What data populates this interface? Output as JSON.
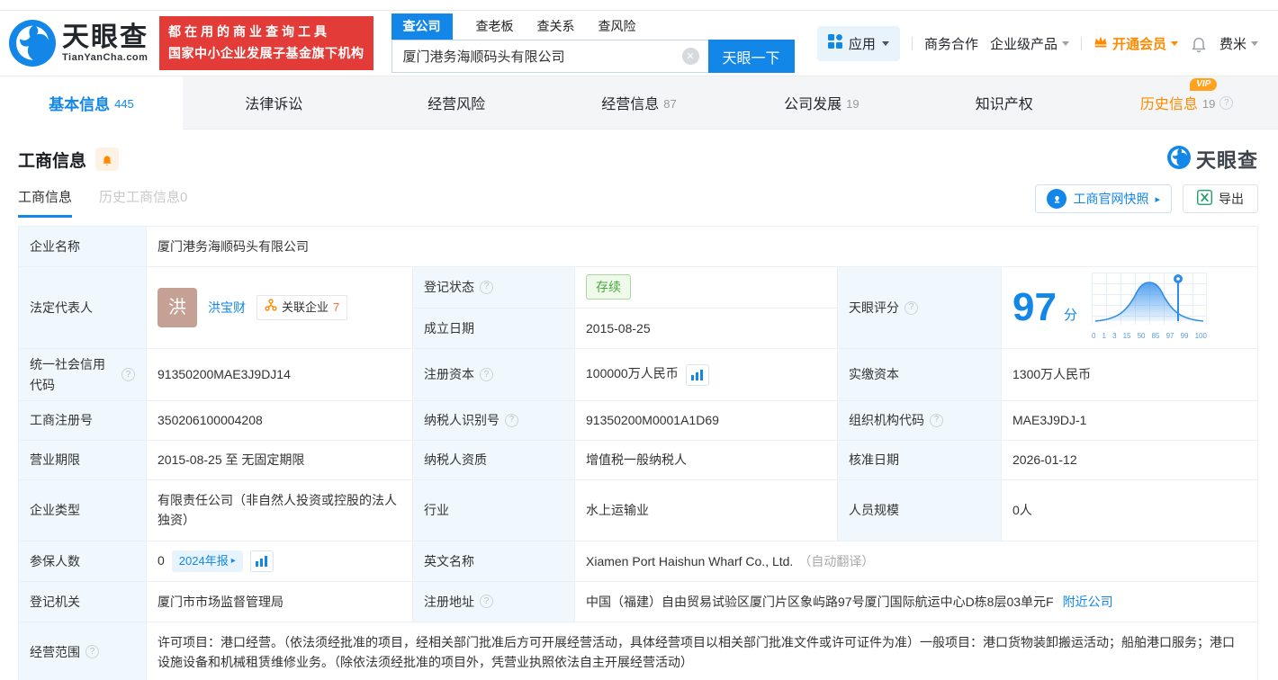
{
  "header": {
    "brand": "天眼查",
    "brand_domain": "TianYanCha.com",
    "slogan_line1": "都在用的商业查询工具",
    "slogan_line2": "国家中小企业发展子基金旗下机构",
    "search_tabs": [
      {
        "label": "查公司"
      },
      {
        "label": "查老板"
      },
      {
        "label": "查关系"
      },
      {
        "label": "查风险"
      }
    ],
    "search_value": "厦门港务海顺码头有限公司",
    "search_button": "天眼一下",
    "menu": {
      "apps": "应用",
      "cooperation": "商务合作",
      "enterprise": "企业级产品",
      "vip": "开通会员",
      "user": "费米"
    }
  },
  "nav_tabs": [
    {
      "label": "基本信息",
      "count": "445"
    },
    {
      "label": "法律诉讼",
      "count": ""
    },
    {
      "label": "经营风险",
      "count": ""
    },
    {
      "label": "经营信息",
      "count": "87"
    },
    {
      "label": "公司发展",
      "count": "19"
    },
    {
      "label": "知识产权",
      "count": ""
    },
    {
      "label": "历史信息",
      "count": "19",
      "vip": "VIP"
    }
  ],
  "section": {
    "title": "工商信息",
    "watermark": "天眼查",
    "subtab_active": "工商信息",
    "subtab_history": "历史工商信息0",
    "snapshot_button": "工商官网快照",
    "export_button": "导出"
  },
  "table": {
    "company_name_label": "企业名称",
    "company_name": "厦门港务海顺码头有限公司",
    "legal_rep_label": "法定代表人",
    "legal_rep_avatar": "洪",
    "legal_rep_name": "洪宝财",
    "related_label": "关联企业",
    "related_count": "7",
    "reg_status_label": "登记状态",
    "reg_status": "存续",
    "establish_date_label": "成立日期",
    "establish_date": "2015-08-25",
    "score_label": "天眼评分",
    "score": "97",
    "score_unit": "分",
    "score_axis": [
      "0",
      "1",
      "3",
      "15",
      "50",
      "85",
      "97",
      "99",
      "100"
    ],
    "credit_code_label": "统一社会信用代码",
    "credit_code": "91350200MAE3J9DJ14",
    "reg_capital_label": "注册资本",
    "reg_capital": "100000万人民币",
    "paid_capital_label": "实缴资本",
    "paid_capital": "1300万人民币",
    "reg_number_label": "工商注册号",
    "reg_number": "350206100004208",
    "taxpayer_id_label": "纳税人识别号",
    "taxpayer_id": "91350200M0001A1D69",
    "org_code_label": "组织机构代码",
    "org_code": "MAE3J9DJ-1",
    "business_term_label": "营业期限",
    "business_term": "2015-08-25 至 无固定期限",
    "taxpayer_quality_label": "纳税人资质",
    "taxpayer_quality": "增值税一般纳税人",
    "approve_date_label": "核准日期",
    "approve_date": "2026-01-12",
    "company_type_label": "企业类型",
    "company_type": "有限责任公司（非自然人投资或控股的法人独资）",
    "industry_label": "行业",
    "industry": "水上运输业",
    "staff_size_label": "人员规模",
    "staff_size": "0人",
    "insured_label": "参保人数",
    "insured": "0",
    "annual_report_badge": "2024年报",
    "english_name_label": "英文名称",
    "english_name": "Xiamen Port Haishun Wharf Co., Ltd.",
    "english_name_note": "（自动翻译）",
    "reg_authority_label": "登记机关",
    "reg_authority": "厦门市市场监督管理局",
    "address_label": "注册地址",
    "address": "中国（福建）自由贸易试验区厦门片区象屿路97号厦门国际航运中心D栋8层03单元F",
    "nearby_link": "附近公司",
    "business_scope_label": "经营范围",
    "business_scope": "许可项目：港口经营。（依法须经批准的项目，经相关部门批准后方可开展经营活动，具体经营项目以相关部门批准文件或许可证件为准）一般项目：港口货物装卸搬运活动；船舶港口服务；港口设施设备和机械租赁维修业务。（除依法须经批准的项目外，凭营业执照依法自主开展经营活动）"
  }
}
